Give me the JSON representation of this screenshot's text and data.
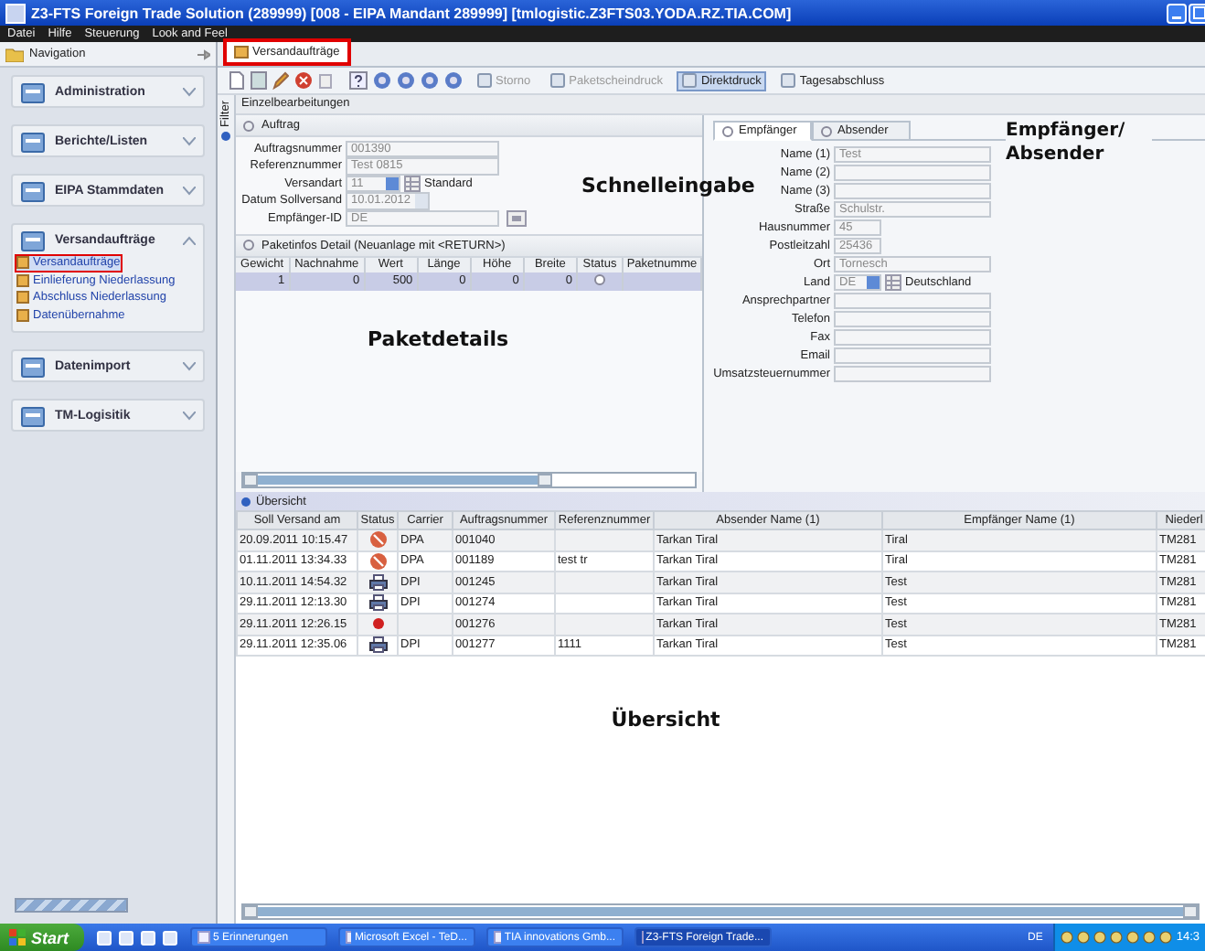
{
  "window": {
    "title": "Z3-FTS Foreign Trade Solution (289999) [008 - EIPA Mandant 289999] [tmlogistic.Z3FTS03.YODA.RZ.TIA.COM]"
  },
  "menu": [
    "Datei",
    "Hilfe",
    "Steuerung",
    "Look and Feel"
  ],
  "navigation": {
    "title": "Navigation",
    "groups": [
      {
        "label": "Administration",
        "expanded": false
      },
      {
        "label": "Berichte/Listen",
        "expanded": false
      },
      {
        "label": "EIPA Stammdaten",
        "expanded": false
      },
      {
        "label": "Versandaufträge",
        "expanded": true,
        "items": [
          {
            "label": "Versandaufträge",
            "selected": true,
            "highlighted": true
          },
          {
            "label": "Einlieferung Niederlassung",
            "selected": false,
            "highlighted": false
          },
          {
            "label": "Abschluss Niederlassung",
            "selected": false,
            "highlighted": false
          },
          {
            "label": "Datenübernahme",
            "selected": false,
            "highlighted": false
          }
        ]
      },
      {
        "label": "Datenimport",
        "expanded": false
      },
      {
        "label": "TM-Logisitik",
        "expanded": false
      }
    ]
  },
  "tabs": [
    {
      "label": "Versandaufträge",
      "selected": true,
      "highlighted": true
    }
  ],
  "toolbar": [
    {
      "label": "Storno",
      "disabled": true,
      "selected": false
    },
    {
      "label": "Paketscheindruck",
      "disabled": true,
      "selected": false
    },
    {
      "label": "Direktdruck",
      "disabled": false,
      "selected": true
    },
    {
      "label": "Tagesabschluss",
      "disabled": false,
      "selected": false
    }
  ],
  "filter_tab": "Filter",
  "section_title": "Einzelbearbeitungen",
  "order_panel": {
    "title": "Auftrag",
    "fields": [
      {
        "label": "Auftragsnummer",
        "value": "001390",
        "kind": "text"
      },
      {
        "label": "Referenznummer",
        "value": "Test 0815",
        "kind": "text"
      },
      {
        "label": "Versandart",
        "value": "11",
        "kind": "combo",
        "extra": "Standard"
      },
      {
        "label": "Datum Sollversand",
        "value": "10.01.2012",
        "kind": "date"
      },
      {
        "label": "Empfänger-ID",
        "value": "DE",
        "kind": "lookup"
      }
    ]
  },
  "package_panel": {
    "title": "Paketinfos Detail (Neuanlage mit <RETURN>)",
    "columns": [
      "Gewicht",
      "Nachnahme",
      "Wert",
      "Länge",
      "Höhe",
      "Breite",
      "Status",
      "Paketnumme"
    ],
    "rows": [
      {
        "cells": [
          "1",
          "0",
          "500",
          "0",
          "0",
          "0"
        ],
        "selected": true
      }
    ]
  },
  "address_panel": {
    "tabs": [
      {
        "label": "Empfänger",
        "selected": true
      },
      {
        "label": "Absender",
        "selected": false
      }
    ],
    "fields": [
      {
        "label": "Name (1)",
        "value": "Test",
        "kind": "text"
      },
      {
        "label": "Name (2)",
        "kind": "text"
      },
      {
        "label": "Name (3)",
        "kind": "text"
      },
      {
        "label": "Straße",
        "value": "Schulstr.",
        "kind": "text"
      },
      {
        "label": "Hausnummer",
        "value": "45",
        "kind": "short"
      },
      {
        "label": "Postleitzahl",
        "value": "25436",
        "kind": "short"
      },
      {
        "label": "Ort",
        "value": "Tornesch",
        "kind": "text"
      },
      {
        "label": "Land",
        "value": "DE",
        "kind": "combo",
        "extra": "Deutschland"
      },
      {
        "label": "Ansprechpartner",
        "kind": "text"
      },
      {
        "label": "Telefon",
        "kind": "text"
      },
      {
        "label": "Fax",
        "kind": "text"
      },
      {
        "label": "Email",
        "kind": "text"
      },
      {
        "label": "Umsatzsteuernummer",
        "kind": "text"
      }
    ]
  },
  "overview": {
    "title": "Übersicht",
    "columns": [
      "Soll Versand am",
      "Status",
      "Carrier",
      "Auftragsnummer",
      "Referenznummer",
      "Absender Name (1)",
      "Empfänger Name (1)",
      "Niederl"
    ],
    "rows": [
      {
        "date": "20.09.2011 10:15.47",
        "kind": "cancelled",
        "carrier": "DPA",
        "order": "001040",
        "reference": "",
        "sender": "Tarkan Tiral",
        "recipient": "Tiral",
        "branch": "TM281"
      },
      {
        "date": "01.11.2011 13:34.33",
        "kind": "cancelled",
        "carrier": "DPA",
        "order": "001189",
        "reference": "test tr",
        "sender": "Tarkan Tiral",
        "recipient": "Tiral",
        "branch": "TM281"
      },
      {
        "date": "10.11.2011 14:54.32",
        "kind": "printed",
        "carrier": "DPI",
        "order": "001245",
        "reference": "",
        "sender": "Tarkan Tiral",
        "recipient": "Test",
        "branch": "TM281"
      },
      {
        "date": "29.11.2011 12:13.30",
        "kind": "printed",
        "carrier": "DPI",
        "order": "001274",
        "reference": "",
        "sender": "Tarkan Tiral",
        "recipient": "Test",
        "branch": "TM281"
      },
      {
        "date": "29.11.2011 12:26.15",
        "kind": "error",
        "carrier": "",
        "order": "001276",
        "reference": "",
        "sender": "Tarkan Tiral",
        "recipient": "Test",
        "branch": "TM281"
      },
      {
        "date": "29.11.2011 12:35.06",
        "kind": "printed",
        "carrier": "DPI",
        "order": "001277",
        "reference": "1111",
        "sender": "Tarkan Tiral",
        "recipient": "Test",
        "branch": "TM281"
      }
    ]
  },
  "annotations": {
    "quick_entry": "Schnelleingabe",
    "package_details": "Paketdetails",
    "recipient_sender": "Empfänger/ Absender",
    "overview": "Übersicht"
  },
  "taskbar": {
    "start": "Start",
    "tasks": [
      {
        "label": "5 Erinnerungen",
        "selected": false
      },
      {
        "label": "Microsoft Excel - TeD...",
        "selected": false
      },
      {
        "label": "TIA innovations Gmb...",
        "selected": false
      },
      {
        "label": "Z3-FTS Foreign Trade...",
        "selected": true
      }
    ],
    "language": "DE",
    "clock": "14:3"
  }
}
